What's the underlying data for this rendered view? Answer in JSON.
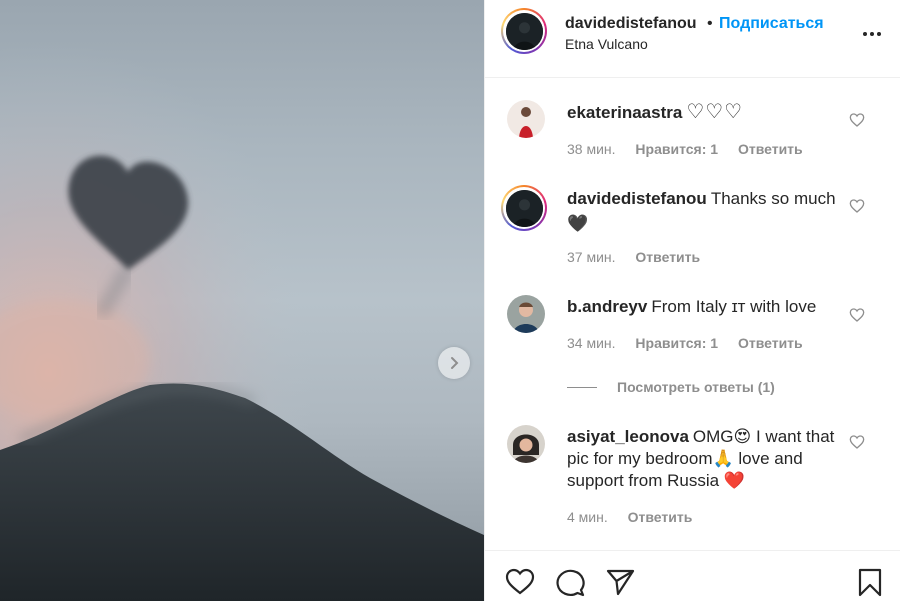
{
  "post": {
    "author": "davidedistefanou",
    "separator": "•",
    "follow_label": "Подписаться",
    "location": "Etna Vulcano",
    "more_icon": "more-horizontal-icon",
    "next_icon": "chevron-right-icon"
  },
  "comments": [
    {
      "username": "ekaterinaastra",
      "text": "♡♡♡",
      "time": "38 мин.",
      "likes": "Нравится: 1",
      "reply_label": "Ответить"
    },
    {
      "username": "davidedistefanou",
      "text": "Thanks so much",
      "emoji": "🖤",
      "time": "37 мин.",
      "reply_label": "Ответить"
    },
    {
      "username": "b.andreyv",
      "text": "From Italy ɪᴛ with love",
      "time": "34 мин.",
      "likes": "Нравится: 1",
      "reply_label": "Ответить",
      "view_replies": "Посмотреть ответы (1)"
    },
    {
      "username": "asiyat_leonova",
      "text_part1": "OMG",
      "emoji1": "😍",
      "text_part2": " I want that pic for my bedroom",
      "emoji2": "🙏",
      "text_part3": " love and support from Russia ",
      "emoji3": "❤️",
      "time": "4 мин.",
      "reply_label": "Ответить"
    }
  ],
  "actions": {
    "like_icon": "heart-icon",
    "comment_icon": "comment-icon",
    "share_icon": "paper-plane-icon",
    "save_icon": "bookmark-icon"
  }
}
